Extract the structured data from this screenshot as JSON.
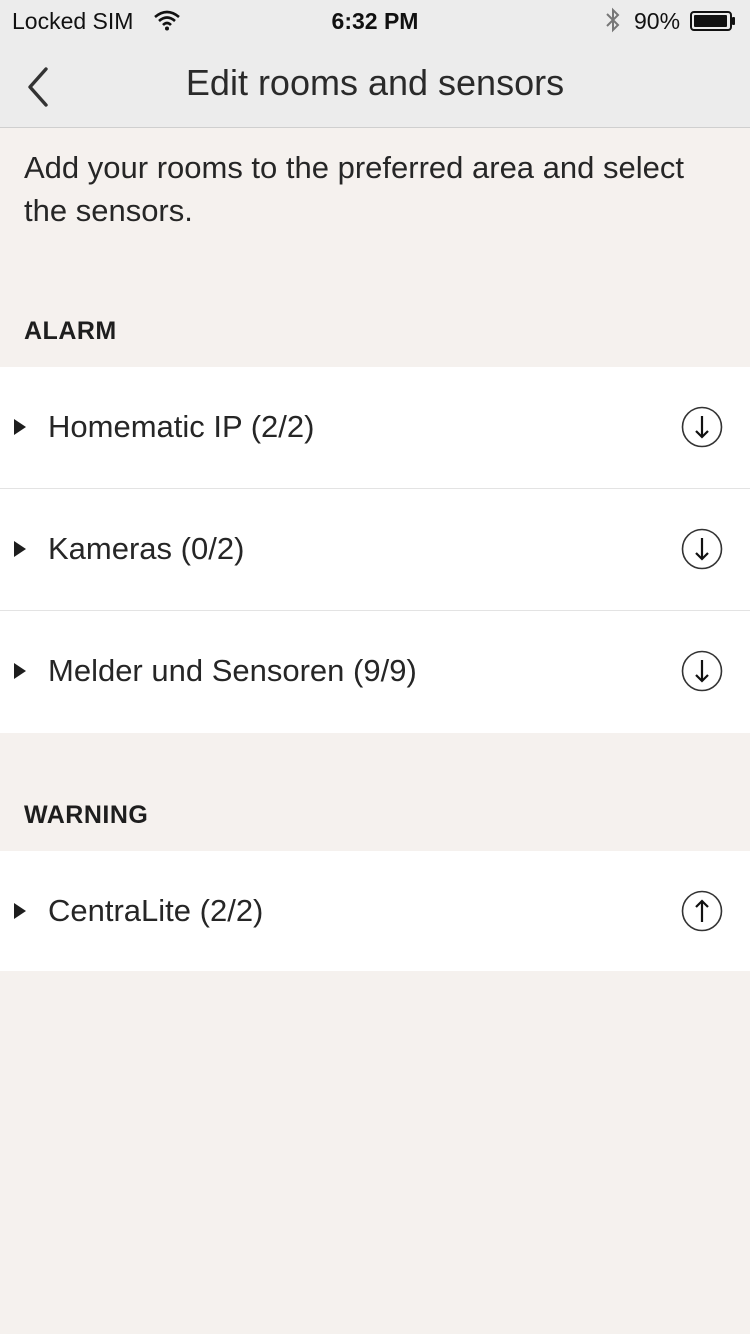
{
  "status_bar": {
    "carrier": "Locked SIM",
    "time": "6:32 PM",
    "battery": "90%",
    "icons": [
      "wifi-icon",
      "bluetooth-icon",
      "battery-icon"
    ]
  },
  "nav": {
    "title": "Edit rooms and sensors",
    "back_icon": "chevron-left-icon"
  },
  "intro": "Add your rooms to the preferred area and select the sensors.",
  "sections": [
    {
      "title": "ALARM",
      "items": [
        {
          "label": "Homematic IP (2/2)",
          "action_icon": "arrow-down-circle-icon"
        },
        {
          "label": "Kameras (0/2)",
          "action_icon": "arrow-down-circle-icon"
        },
        {
          "label": "Melder und Sensoren (9/9)",
          "action_icon": "arrow-down-circle-icon"
        }
      ]
    },
    {
      "title": "WARNING",
      "items": [
        {
          "label": "CentraLite (2/2)",
          "action_icon": "arrow-up-circle-icon"
        }
      ]
    }
  ],
  "colors": {
    "background": "#f5f1ee",
    "navbar": "#ececec",
    "row_background": "#ffffff",
    "text": "#262626"
  }
}
